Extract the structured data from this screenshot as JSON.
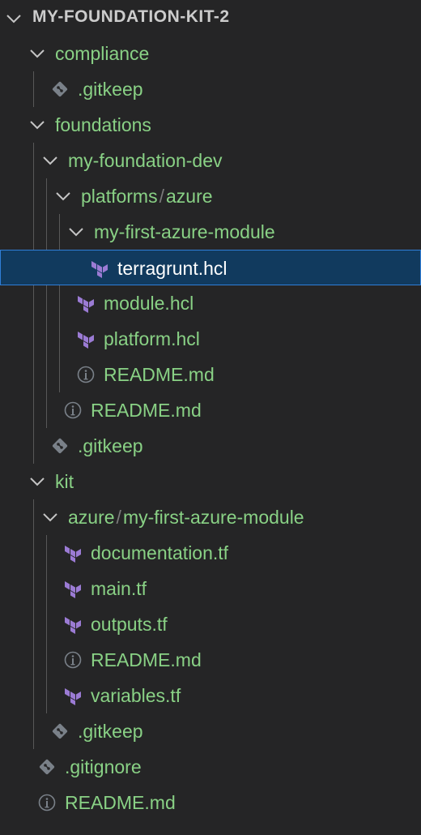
{
  "explorer": {
    "root_title": "MY-FOUNDATION-KIT-2",
    "colors": {
      "background": "#252526",
      "label": "#89d185",
      "selected_bg": "#113a5e",
      "selected_border": "#2f7ed8",
      "terraform_icon": "#9b7bd4",
      "muted_icon": "#7a8189"
    },
    "items": [
      {
        "label": "compliance",
        "kind": "folder-open",
        "depth": 0
      },
      {
        "label": ".gitkeep",
        "kind": "git-file",
        "depth": 1
      },
      {
        "label": "foundations",
        "kind": "folder-open",
        "depth": 0
      },
      {
        "label": "my-foundation-dev",
        "kind": "folder-open",
        "depth": 1
      },
      {
        "label": "platforms",
        "label2": "azure",
        "kind": "folder-open",
        "depth": 2
      },
      {
        "label": "my-first-azure-module",
        "kind": "folder-open",
        "depth": 3
      },
      {
        "label": "terragrunt.hcl",
        "kind": "terraform-file",
        "depth": 4,
        "selected": true
      },
      {
        "label": "module.hcl",
        "kind": "terraform-file",
        "depth": 3
      },
      {
        "label": "platform.hcl",
        "kind": "terraform-file",
        "depth": 3
      },
      {
        "label": "README.md",
        "kind": "info-file",
        "depth": 3
      },
      {
        "label": "README.md",
        "kind": "info-file",
        "depth": 2
      },
      {
        "label": ".gitkeep",
        "kind": "git-file",
        "depth": 1
      },
      {
        "label": "kit",
        "kind": "folder-open",
        "depth": 0
      },
      {
        "label": "azure",
        "label2": "my-first-azure-module",
        "kind": "folder-open",
        "depth": 1
      },
      {
        "label": "documentation.tf",
        "kind": "terraform-file",
        "depth": 2
      },
      {
        "label": "main.tf",
        "kind": "terraform-file",
        "depth": 2
      },
      {
        "label": "outputs.tf",
        "kind": "terraform-file",
        "depth": 2
      },
      {
        "label": "README.md",
        "kind": "info-file",
        "depth": 2
      },
      {
        "label": "variables.tf",
        "kind": "terraform-file",
        "depth": 2
      },
      {
        "label": ".gitkeep",
        "kind": "git-file",
        "depth": 1
      },
      {
        "label": ".gitignore",
        "kind": "git-file",
        "depth": 0
      },
      {
        "label": "README.md",
        "kind": "info-file",
        "depth": 0
      }
    ]
  }
}
